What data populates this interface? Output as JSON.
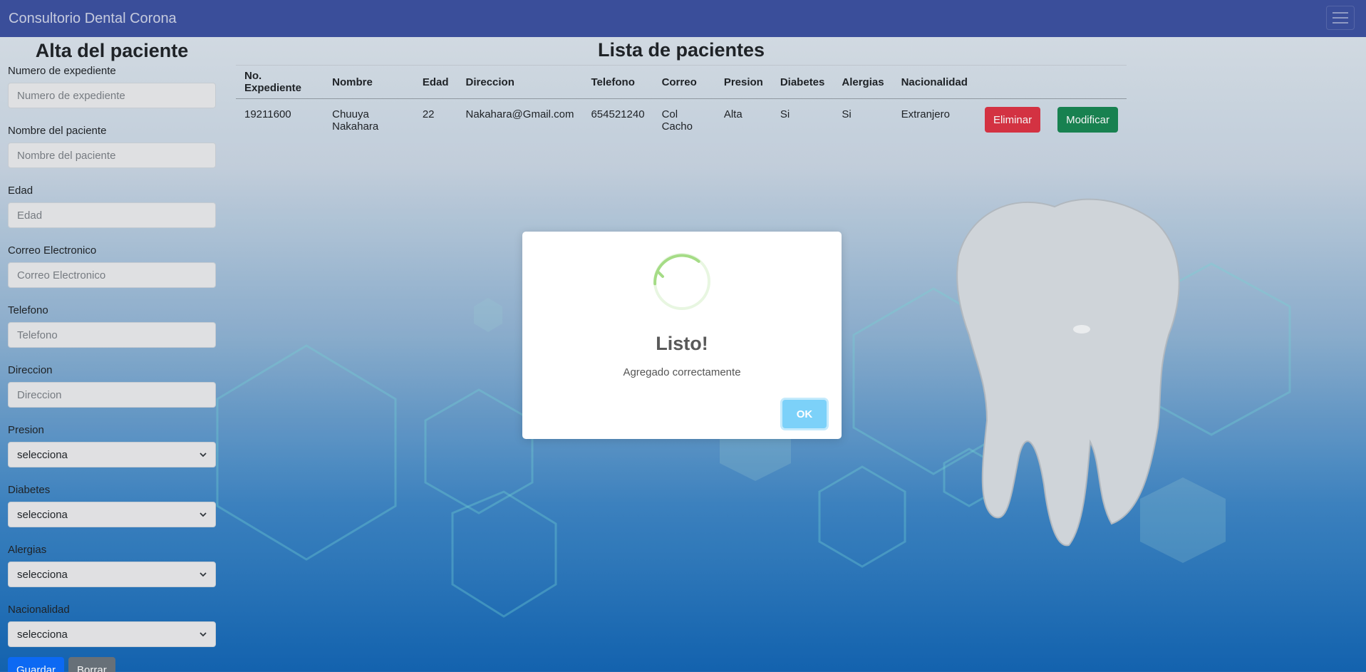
{
  "navbar": {
    "brand": "Consultorio Dental Corona",
    "menu_icon": "hamburger-icon"
  },
  "form": {
    "title": "Alta del paciente",
    "fields": [
      {
        "label": "Numero de expediente",
        "placeholder": "Numero de expediente"
      },
      {
        "label": "Nombre del paciente",
        "placeholder": "Nombre del paciente"
      },
      {
        "label": "Edad",
        "placeholder": "Edad"
      },
      {
        "label": "Correo Electronico",
        "placeholder": "Correo Electronico"
      },
      {
        "label": "Telefono",
        "placeholder": "Telefono"
      },
      {
        "label": "Direccion",
        "placeholder": "Direccion"
      }
    ],
    "selects": [
      {
        "label": "Presion",
        "value": "selecciona"
      },
      {
        "label": "Diabetes",
        "value": "selecciona"
      },
      {
        "label": "Alergias",
        "value": "selecciona"
      },
      {
        "label": "Nacionalidad",
        "value": "selecciona"
      }
    ],
    "save_label": "Guardar",
    "clear_label": "Borrar"
  },
  "list": {
    "title": "Lista de pacientes",
    "headers": [
      "No. Expediente",
      "Nombre",
      "Edad",
      "Direccion",
      "Telefono",
      "Correo",
      "Presion",
      "Diabetes",
      "Alergias",
      "Nacionalidad"
    ],
    "rows": [
      {
        "cells": [
          "19211600",
          "Chuuya Nakahara",
          "22",
          "Nakahara@Gmail.com",
          "654521240",
          "Col Cacho",
          "Alta",
          "Si",
          "Si",
          "Extranjero"
        ],
        "delete_label": "Eliminar",
        "edit_label": "Modificar"
      }
    ]
  },
  "dialog": {
    "title": "Listo!",
    "message": "Agregado correctamente",
    "ok_label": "OK",
    "icon": "success-spinner-icon"
  },
  "colors": {
    "navbar": "#3d52a1",
    "primary": "#0d6efd",
    "secondary": "#6c757d",
    "danger": "#dc3545",
    "success": "#198754",
    "ok": "#7cd1f9"
  }
}
